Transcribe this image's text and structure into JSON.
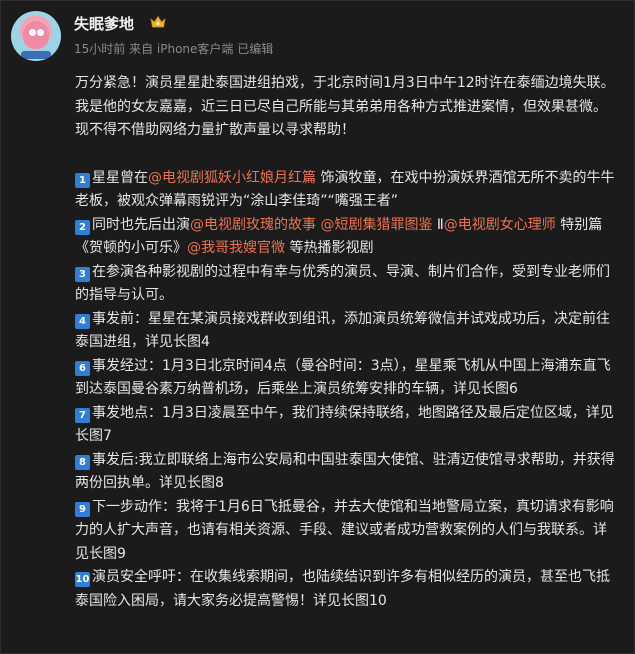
{
  "post": {
    "author": "失眠爹地",
    "meta": "15小时前 来自 iPhone客户端 已编辑",
    "intro": [
      "万分紧急！演员星星赴泰国进组拍戏，于北京时间1月3日中午12时许在泰缅边境失联。",
      "我是他的女友嘉嘉，近三日已尽自己所能与其弟弟用各种方式推进案情，但效果甚微。现不得不借助网络力量扩散声量以寻求帮助！"
    ],
    "items": [
      {
        "num": "1",
        "segments": [
          {
            "text": "星星曾在",
            "link": false
          },
          {
            "text": "@电视剧狐妖小红娘月红篇",
            "link": true
          },
          {
            "text": " 饰演牧童，在戏中扮演妖界酒馆无所不卖的牛牛老板，被观众弹幕雨锐评为“涂山李佳琦”“嘴强王者”",
            "link": false
          }
        ]
      },
      {
        "num": "2",
        "segments": [
          {
            "text": "同时也先后出演",
            "link": false
          },
          {
            "text": "@电视剧玫瑰的故事",
            "link": true
          },
          {
            "text": " ",
            "link": false
          },
          {
            "text": "@短剧集猎罪图鉴",
            "link": true
          },
          {
            "text": " Ⅱ",
            "link": false
          },
          {
            "text": "@电视剧女心理师",
            "link": true
          },
          {
            "text": " 特别篇 《贺顿的小可乐》",
            "link": false
          },
          {
            "text": "@我哥我嫂官微",
            "link": true
          },
          {
            "text": " 等热播影视剧",
            "link": false
          }
        ]
      },
      {
        "num": "3",
        "segments": [
          {
            "text": "在参演各种影视剧的过程中有幸与优秀的演员、导演、制片们合作，受到专业老师们的指导与认可。",
            "link": false
          }
        ]
      },
      {
        "num": "4",
        "segments": [
          {
            "text": "事发前：星星在某演员接戏群收到组讯，添加演员统筹微信并试戏成功后，决定前往泰国进组，详见长图4",
            "link": false
          }
        ]
      },
      {
        "num": "6",
        "segments": [
          {
            "text": "事发经过：1月3日北京时间4点（曼谷时间：3点），星星乘飞机从中国上海浦东直飞到达泰国曼谷素万纳普机场，后乘坐上演员统筹安排的车辆，详见长图6",
            "link": false
          }
        ]
      },
      {
        "num": "7",
        "segments": [
          {
            "text": "事发地点：1月3日凌晨至中午，我们持续保持联络，地图路径及最后定位区域，详见长图7",
            "link": false
          }
        ]
      },
      {
        "num": "8",
        "segments": [
          {
            "text": "事发后:我立即联络上海市公安局和中国驻泰国大使馆、驻清迈使馆寻求帮助，并获得两份回执单。详见长图8",
            "link": false
          }
        ]
      },
      {
        "num": "9",
        "segments": [
          {
            "text": "下一步动作：我将于1月6日飞抵曼谷，并去大使馆和当地警局立案，真切请求有影响力的人扩大声音，也请有相关资源、手段、建议或者成功营救案例的人们与我联系。详见长图9",
            "link": false
          }
        ]
      },
      {
        "num": "10",
        "segments": [
          {
            "text": "演员安全呼吁：在收集线索期间，也陆续结识到许多有相似经历的演员，甚至也飞抵泰国险入困局，请大家务必提高警惕！详见长图10",
            "link": false
          }
        ]
      }
    ]
  },
  "colors": {
    "background": "#1b1b1b",
    "text": "#e6e6e6",
    "link": "#eb7350",
    "number_badge": "#2f7fd8",
    "meta": "#8a8a8a"
  },
  "icons": {
    "vip_badge": "crown-badge-icon"
  }
}
